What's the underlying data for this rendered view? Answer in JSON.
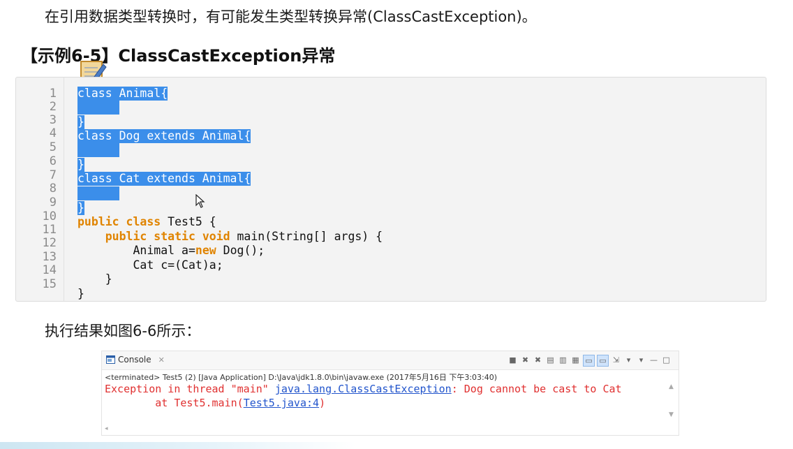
{
  "intro": "在引用数据类型转换时，有可能发生类型转换异常(ClassCastException)。",
  "example_title": "【示例6-5】ClassCastException异常",
  "line_numbers": [
    "1",
    "2",
    "3",
    "4",
    "5",
    "6",
    "7",
    "8",
    "9",
    "10",
    "11",
    "12",
    "13",
    "14",
    "15"
  ],
  "code": {
    "l1": "class Animal{",
    "l3": "}",
    "l4": "class Dog extends Animal{",
    "l6": "}",
    "l7": "class Cat extends Animal{",
    "l9": "}",
    "l10_kw": "public class",
    "l10_rest": " Test5 {",
    "l11_kw": "public static void",
    "l11_rest": " main(String[] args) {",
    "l12_a": "Animal a=",
    "l12_kw": "new",
    "l12_b": " Dog();",
    "l13": "Cat c=(Cat)a;",
    "l14": "}",
    "l15": "}"
  },
  "result_text": "执行结果如图6-6所示：",
  "console": {
    "tab_label": "Console",
    "close": "✕",
    "terminated": "<terminated> Test5 (2) [Java Application] D:\\Java\\jdk1.8.0\\bin\\javaw.exe (2017年5月16日 下午3:03:40)",
    "err1_a": "Exception in thread \"main\" ",
    "err1_link": "java.lang.ClassCastException",
    "err1_b": ": Dog cannot be cast to Cat",
    "err2_a": "        at Test5.main(",
    "err2_link": "Test5.java:4",
    "err2_b": ")"
  },
  "colors": {
    "selection": "#3b8eea",
    "keyword": "#e08400",
    "error": "#e03030",
    "link": "#2255cc"
  }
}
